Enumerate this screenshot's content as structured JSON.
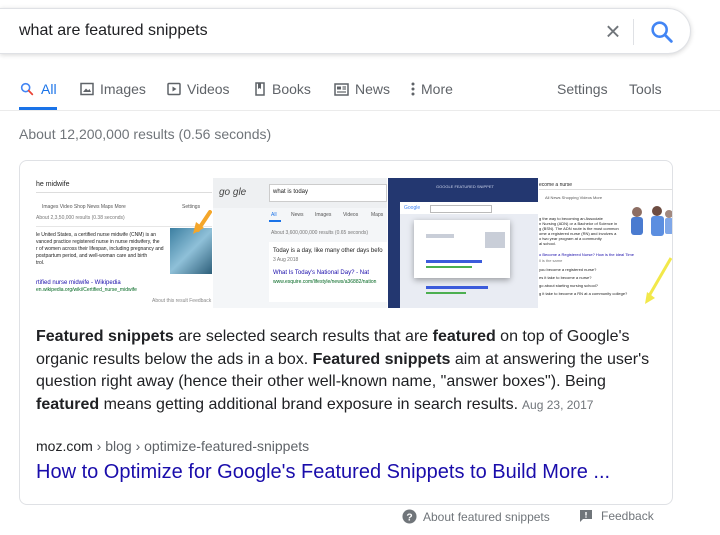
{
  "search": {
    "query": "what are featured snippets",
    "clear_label": "×"
  },
  "tabs": [
    {
      "label": "All",
      "icon": "search-icon",
      "active": true
    },
    {
      "label": "Images",
      "icon": "image-icon"
    },
    {
      "label": "Videos",
      "icon": "play-icon"
    },
    {
      "label": "Books",
      "icon": "book-icon"
    },
    {
      "label": "News",
      "icon": "news-icon"
    },
    {
      "label": "More",
      "icon": "more-vert-icon"
    },
    {
      "label": "Settings"
    },
    {
      "label": "Tools"
    }
  ],
  "stats": "About 12,200,000 results (0.56 seconds)",
  "thumbnails": {
    "t1": {
      "header": "he midwife",
      "tabs": "Images   Video   Shop   News   Maps   More",
      "settings": "Settings",
      "count": "About 2,3,50,000 results (0.38 seconds)",
      "lines": [
        "le United States, a certified nurse midwife (CNM) is an",
        "vanced practice registered nurse in nurse midwifery, the",
        "r of women across their lifespan, including pregnancy and",
        "postpartum period, and well-woman care and birth",
        "trol."
      ],
      "wiki": "rtified nurse midwife - Wikipedia",
      "wiki_url": "en.wikipedia.org/wiki/Certified_nurse_midwife",
      "foot": "About this result   Feedback"
    },
    "t2": {
      "logo": "go gle",
      "query": "what is today",
      "tabs": [
        "All",
        "News",
        "Images",
        "Videos",
        "Maps"
      ],
      "count": "About 3,600,000,000 results (0.65 seconds)",
      "line1": "Today is a day, like many other days befo",
      "date": "3 Aug 2018",
      "link": "What Is Today's National Day? - Nat",
      "url": "www.esquire.com/lifestyle/news/a36882/nation"
    },
    "t3": {
      "title": "GOOGLE FEATURED SNIPPET",
      "logo": "Google"
    },
    "t4": {
      "header": "ecome a nurse",
      "tabs": "All   News   Shopping   Videos   More",
      "lines": [
        "g the way to becoming an Associate",
        "n Nursing (ADN) or a Bachelor of Science in",
        "g (BSN). The ADN route is the most common",
        "ome a registered nurse (RN) and involves a",
        "o two year program at a community",
        "al school."
      ],
      "qa": [
        "o Become a Registered Nurse? How is the ideal Time",
        "ll is the same",
        "you become a registered nurse?",
        "es it take to become a nurse?",
        "go about starting nursing school?",
        "g it take to become a RN at a community college?"
      ]
    }
  },
  "snippet": {
    "p1": "Featured snippets",
    "p2": " are selected search results that are ",
    "p3": "featured",
    "p4": " on top of Google's organic results below the ads in a box. ",
    "p5": "Featured snippets",
    "p6": " aim at answering the user's question right away (hence their other well-known name, \"answer boxes\"). Being ",
    "p7": "featured",
    "p8": " means getting additional brand exposure in search results.",
    "date": "Aug 23, 2017"
  },
  "result": {
    "domain": "moz.com",
    "breadcrumb": " › blog › optimize-featured-snippets",
    "title": "How to Optimize for Google's Featured Snippets to Build More ..."
  },
  "footer": {
    "about": "About featured snippets",
    "feedback": "Feedback"
  },
  "colors": {
    "accent": "#1a73e8",
    "link": "#1a0dab",
    "muted": "#70757a"
  }
}
